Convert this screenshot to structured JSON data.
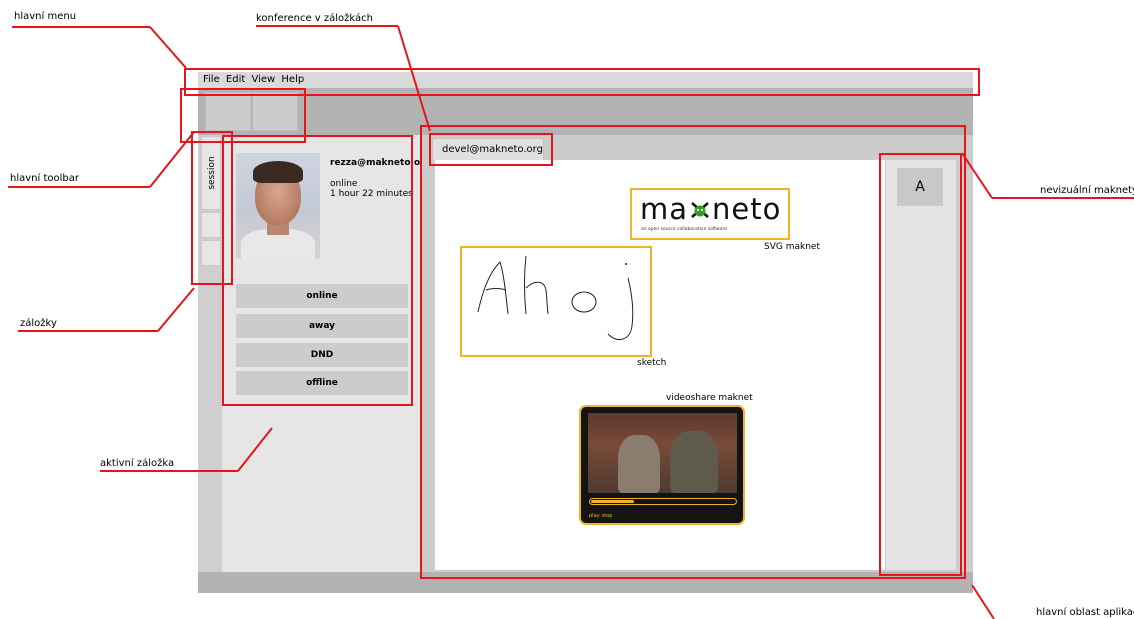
{
  "annotations": {
    "main_menu": "hlavní menu",
    "tabbed_conferences": "konference v záložkách",
    "main_toolbar": "hlavní toolbar",
    "non_visual_maknets": "nevizuální maknety",
    "tabs": "záložky",
    "active_tab": "aktivní záložka",
    "main_app_area": "hlavní oblast aplikace"
  },
  "annotation_color": "#e8141c",
  "maknet_border_color": "#f0b42a",
  "menu": {
    "items": [
      "File",
      "Edit",
      "View",
      "Help"
    ]
  },
  "toolbar": {
    "buttons": [
      "toolbar-button",
      "toolbar-button"
    ]
  },
  "sidebar": {
    "tabs": [
      {
        "label": "session",
        "active": true
      },
      {
        "label": ""
      },
      {
        "label": ""
      }
    ]
  },
  "session": {
    "jid": "rezza@makneto.org",
    "status": "online",
    "duration": "1 hour 22 minutes",
    "buttons": {
      "online": "online",
      "away": "away",
      "dnd": "DND",
      "offline": "offline"
    }
  },
  "conference": {
    "tab_label": "devel@makneto.org"
  },
  "maknets": {
    "svg": {
      "logo_text_left": "ma",
      "logo_text_right": "neto",
      "logo_tagline": "an open source collaborative software",
      "caption": "SVG maknet"
    },
    "sketch": {
      "caption": "sketch",
      "drawn_text": "Ahoj"
    },
    "video": {
      "caption": "videoshare maknet",
      "controls": [
        "play",
        "stop"
      ],
      "progress": 0.3
    }
  },
  "non_visual": {
    "button_label": "A"
  }
}
